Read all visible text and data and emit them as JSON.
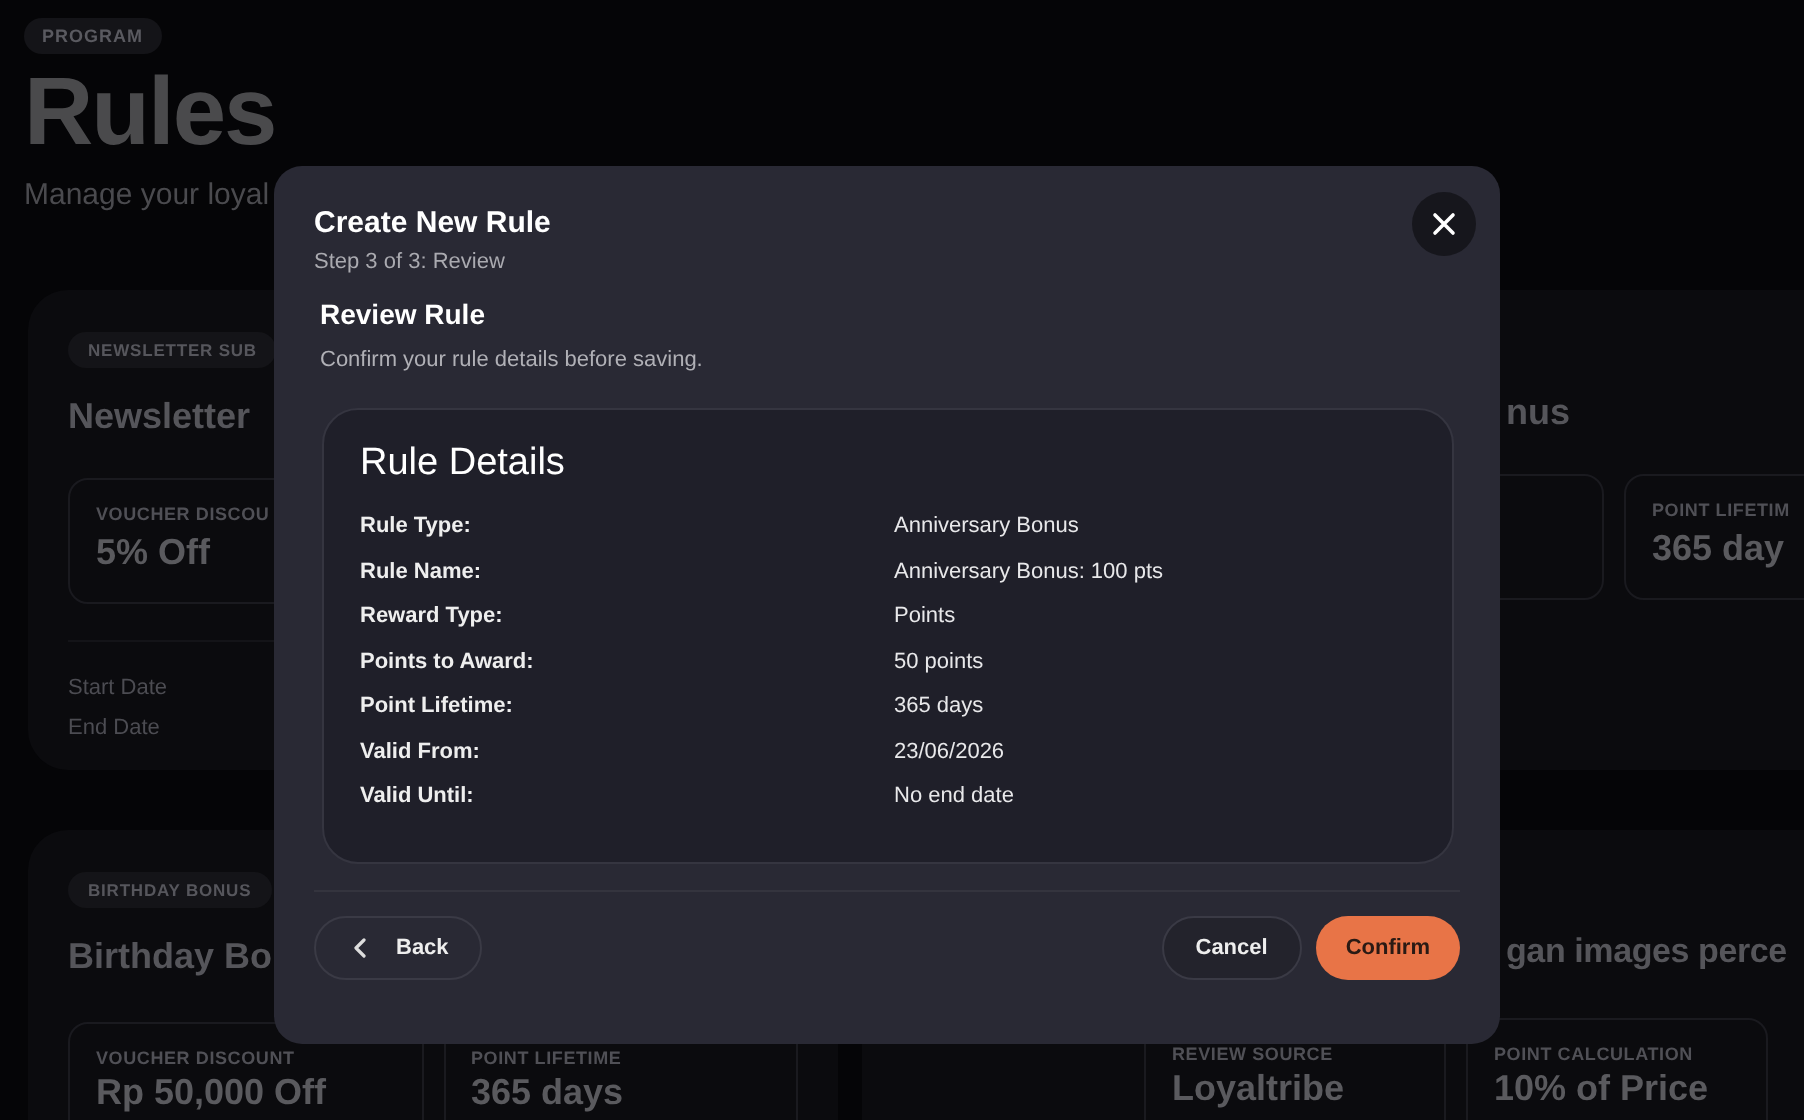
{
  "page": {
    "badge": "PROGRAM",
    "title": "Rules",
    "subtitle": "Manage your loyal"
  },
  "rule_cards": [
    {
      "tag": "NEWSLETTER SUB",
      "title": "Newsletter",
      "stats": [
        {
          "label": "VOUCHER DISCOU",
          "value": "5% Off"
        }
      ],
      "dates": [
        "Start Date",
        "End Date"
      ]
    },
    {
      "title": "nus",
      "stats": [
        {
          "label": "POINT LIFETIM",
          "value": "365 day"
        }
      ]
    },
    {
      "tag": "BIRTHDAY BONUS",
      "title": "Birthday Bo",
      "stats": [
        {
          "label": "VOUCHER DISCOUNT",
          "value": "Rp 50,000 Off"
        },
        {
          "label": "POINT LIFETIME",
          "value": "365 days"
        }
      ]
    },
    {
      "title": "gan images perce",
      "stats": [
        {
          "label": "REVIEW SOURCE",
          "value": "Loyaltribe"
        },
        {
          "label": "POINT CALCULATION",
          "value": "10% of Price"
        }
      ]
    }
  ],
  "dialog": {
    "title": "Create New Rule",
    "step": "Step 3 of 3: Review",
    "section_title": "Review Rule",
    "section_subtitle": "Confirm your rule details before saving.",
    "details": {
      "title": "Rule Details",
      "rows": [
        {
          "label": "Rule Type:",
          "value": "Anniversary Bonus"
        },
        {
          "label": "Rule Name:",
          "value": "Anniversary Bonus: 100 pts"
        },
        {
          "label": "Reward Type:",
          "value": "Points"
        },
        {
          "label": "Points to Award:",
          "value": "50 points"
        },
        {
          "label": "Point Lifetime:",
          "value": "365 days"
        },
        {
          "label": "Valid From:",
          "value": "23/06/2026"
        },
        {
          "label": "Valid Until:",
          "value": "No end date"
        }
      ]
    },
    "buttons": [
      {
        "kind": "back",
        "label": "Back"
      },
      {
        "kind": "secondary",
        "label": "Cancel"
      },
      {
        "kind": "primary",
        "label": "Confirm"
      }
    ]
  }
}
